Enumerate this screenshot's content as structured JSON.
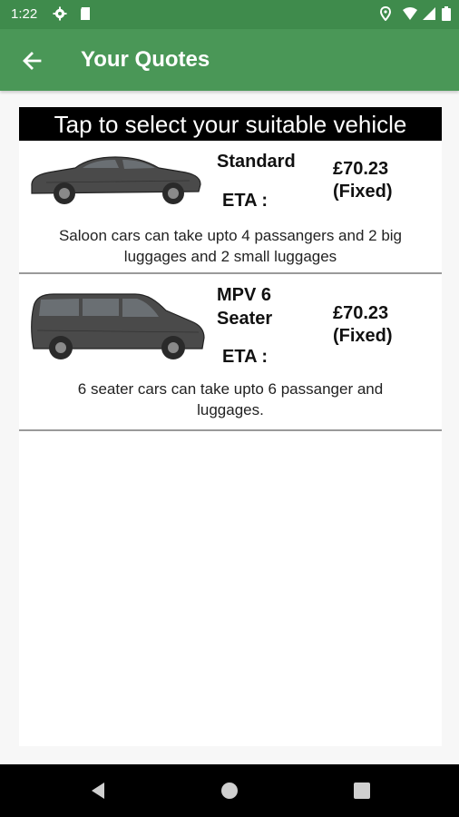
{
  "status_bar": {
    "time": "1:22",
    "left_icons": [
      "gear-icon",
      "sd-card-icon"
    ],
    "right_icons": [
      "location-icon",
      "wifi-icon",
      "signal-icon",
      "battery-icon"
    ]
  },
  "app_bar": {
    "title": "Your Quotes",
    "back_icon": "arrow-back-icon",
    "color": "#4a9757"
  },
  "banner": {
    "text": "Tap to select your suitable vehicle"
  },
  "quotes": [
    {
      "vehicle": "Standard",
      "eta_label": "ETA :",
      "price": "£70.23",
      "price_type": "(Fixed)",
      "description": "Saloon cars can take upto 4 passangers and 2 big luggages and 2 small luggages",
      "image": "saloon-car-icon"
    },
    {
      "vehicle": "MPV 6 Seater",
      "eta_label": "ETA :",
      "price": "£70.23",
      "price_type": "(Fixed)",
      "description": "6 seater cars can take upto 6 passanger and luggages.",
      "image": "mpv-van-icon"
    }
  ],
  "nav_bar": {
    "buttons": [
      "back-nav-icon",
      "home-nav-icon",
      "recents-nav-icon"
    ]
  }
}
